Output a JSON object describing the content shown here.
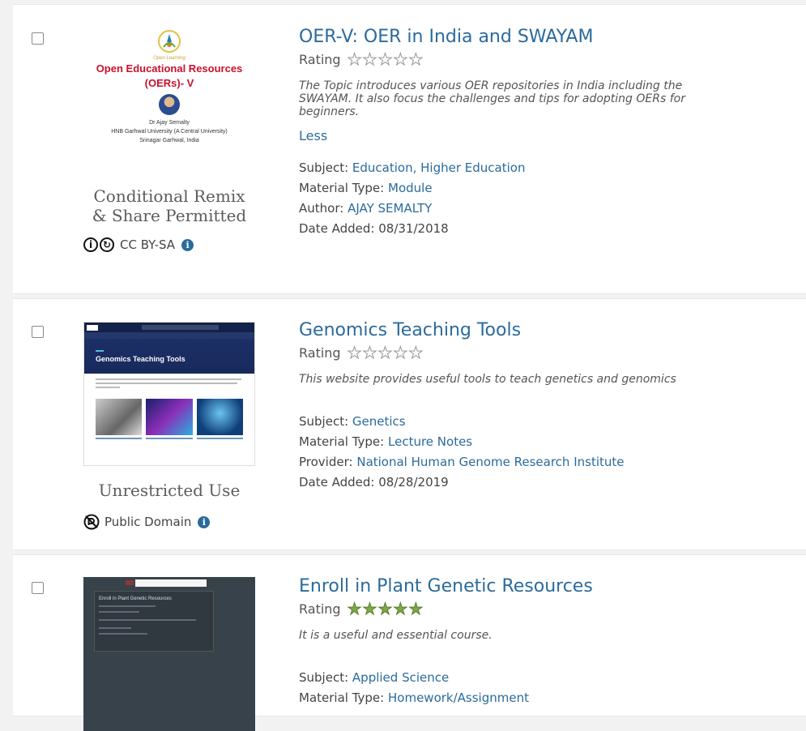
{
  "results": [
    {
      "title": "OER-V: OER in India and SWAYAM",
      "rating_label": "Rating",
      "rating_stars": 0,
      "description": "The Topic introduces various OER repositories  in India including the SWAYAM. It also focus the challenges and tips for adopting OERs for beginners.",
      "less_label": "Less",
      "subject_label": "Subject:",
      "subjects": [
        "Education",
        "Higher Education"
      ],
      "subject_sep": ", ",
      "type_label": "Material Type:",
      "type": "Module",
      "person_label": "Author:",
      "person": "AJAY SEMALTY",
      "date_label": "Date Added:",
      "date": "08/31/2018",
      "license_text_1": "Conditional Remix",
      "license_text_2": "& Share Permitted",
      "license_name": "CC BY-SA",
      "thumb": {
        "heading_1": "Open Educational Resources",
        "heading_2": "(OERs)- V",
        "name": "Dr Ajay Semalty",
        "affil_1": "HNB Garhwal University (A Central University)",
        "affil_2": "Srinagar Garhwal, India",
        "logo_caption": "Open Learning"
      }
    },
    {
      "title": "Genomics Teaching Tools",
      "rating_label": "Rating",
      "rating_stars": 0,
      "description": "This website provides useful tools to teach genetics and genomics",
      "subject_label": "Subject:",
      "subjects": [
        "Genetics"
      ],
      "type_label": "Material Type:",
      "type": "Lecture Notes",
      "person_label": "Provider:",
      "person": "National Human Genome Research Institute",
      "date_label": "Date Added:",
      "date": "08/28/2019",
      "license_text_1": "Unrestricted Use",
      "license_name": "Public Domain",
      "thumb": {
        "hero_title": "Genomics Teaching Tools"
      }
    },
    {
      "title": "Enroll in Plant Genetic Resources",
      "rating_label": "Rating",
      "rating_stars": 5,
      "description": "It is a useful and essential course.",
      "subject_label": "Subject:",
      "subjects": [
        "Applied Science"
      ],
      "type_label": "Material Type:",
      "type": "Homework/Assignment",
      "thumb": {
        "box_title": "Enroll in Plant Genetic Resources"
      }
    }
  ],
  "icons": {
    "cc_by": "cc-by-icon",
    "cc_sa": "cc-sa-icon",
    "public_domain": "public-domain-icon",
    "info": "info-icon",
    "star": "star-icon"
  },
  "colors": {
    "link": "#2b6b9c",
    "star_filled": "#7fa84a",
    "oer_red": "#c8102e"
  }
}
